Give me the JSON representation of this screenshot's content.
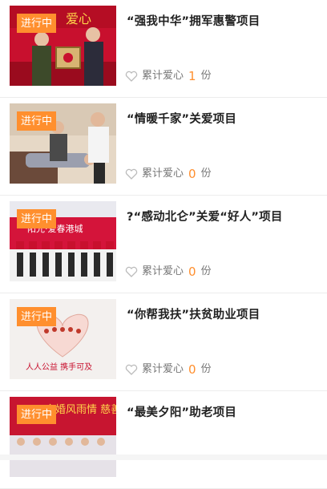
{
  "projects": [
    {
      "status": "进行中",
      "title": "“强我中华”拥军惠警项目",
      "meta_label": "累计爱心",
      "count": "1",
      "unit": "份",
      "image_text": "爱心"
    },
    {
      "status": "进行中",
      "title": "“情暖千家”关爱项目",
      "meta_label": "累计爱心",
      "count": "0",
      "unit": "份",
      "image_text": ""
    },
    {
      "status": "进行中",
      "title": "?“感动北仑”关爱“好人”项目",
      "meta_label": "累计爱心",
      "count": "0",
      "unit": "份",
      "image_text": "阳光·爱春港城"
    },
    {
      "status": "进行中",
      "title": "“你帮我扶”扶贫助业项目",
      "meta_label": "累计爱心",
      "count": "0",
      "unit": "份",
      "image_text": "人人公益 携手可及"
    },
    {
      "status": "进行中",
      "title": "“最美夕阳”助老项目",
      "meta_label": "",
      "count": "",
      "unit": "",
      "image_text": "金婚风雨情 慈善暖人心"
    }
  ],
  "colors": {
    "accent": "#ff8f2e",
    "title": "#222222",
    "meta": "#777777",
    "divider": "#ececec"
  },
  "icons": {
    "like": "heart-outline-icon"
  }
}
